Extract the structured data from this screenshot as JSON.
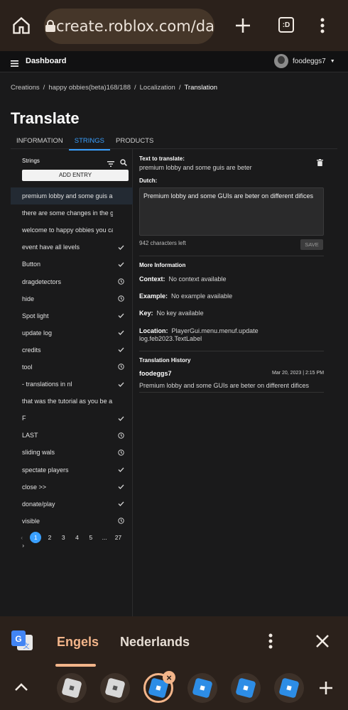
{
  "browser": {
    "url": "create.roblox.com/da",
    "tab_count": ":D"
  },
  "topnav": {
    "title": "Dashboard",
    "username": "foodeggs7"
  },
  "breadcrumb": [
    "Creations",
    "/",
    "happy obbies(beta)168/188",
    "/",
    "Localization",
    "/",
    "Translation"
  ],
  "page_title": "Translate",
  "tabs": [
    {
      "label": "INFORMATION",
      "active": false
    },
    {
      "label": "STRINGS",
      "active": true
    },
    {
      "label": "PRODUCTS",
      "active": false
    }
  ],
  "strings_panel": {
    "header": "Strings",
    "add_entry": "ADD ENTRY",
    "items": [
      {
        "text": "premium lobby and some guis are beter",
        "status": "none",
        "selected": true
      },
      {
        "text": "there are some changes in the game",
        "status": "none",
        "selected": false
      },
      {
        "text": "welcome to happy obbies you can play",
        "status": "none",
        "selected": false
      },
      {
        "text": "event have all levels",
        "status": "check",
        "selected": false
      },
      {
        "text": "Button",
        "status": "check",
        "selected": false
      },
      {
        "text": "dragdetectors",
        "status": "clock",
        "selected": false
      },
      {
        "text": "hide",
        "status": "clock",
        "selected": false
      },
      {
        "text": "Spot light",
        "status": "check",
        "selected": false
      },
      {
        "text": "update log",
        "status": "check",
        "selected": false
      },
      {
        "text": "credits",
        "status": "check",
        "selected": false
      },
      {
        "text": "tool",
        "status": "clock",
        "selected": false
      },
      {
        "text": "- translations in nl",
        "status": "check",
        "selected": false
      },
      {
        "text": "that was the tutorial as you be a.bet",
        "status": "none",
        "selected": false
      },
      {
        "text": "F",
        "status": "check",
        "selected": false
      },
      {
        "text": "LAST",
        "status": "clock",
        "selected": false
      },
      {
        "text": "sliding wals",
        "status": "clock",
        "selected": false
      },
      {
        "text": "spectate players",
        "status": "check",
        "selected": false
      },
      {
        "text": "close >>",
        "status": "check",
        "selected": false
      },
      {
        "text": "donate/play",
        "status": "check",
        "selected": false
      },
      {
        "text": "visible",
        "status": "clock",
        "selected": false
      }
    ],
    "pagination": {
      "pages": [
        "1",
        "2",
        "3",
        "4",
        "5",
        "...",
        "27"
      ],
      "current": "1",
      "prev": "‹",
      "next": "›"
    }
  },
  "translation": {
    "text_label": "Text to translate:",
    "source_text": "premium lobby and some guis are beter",
    "lang_label": "Dutch:",
    "translated_text": "Premium lobby and some GUIs are beter on different difices",
    "chars_left": "942 characters left",
    "save": "SAVE",
    "more_info_label": "More Information",
    "context_label": "Context:",
    "context_value": "No context available",
    "example_label": "Example:",
    "example_value": "No example available",
    "key_label": "Key:",
    "key_value": "No key available",
    "location_label": "Location:",
    "location_value_1": "PlayerGui.menu.menuf.update",
    "location_value_2": "log.feb2023.TextLabel",
    "history_label": "Translation History",
    "history_user": "foodeggs7",
    "history_date": "Mar 20, 2023 | 2:15 PM",
    "history_text": "Premium lobby and some GUIs are beter on different difices"
  },
  "translate_bar": {
    "lang_from": "Engels",
    "lang_to": "Nederlands"
  },
  "colors": {
    "accent": "#3aa0ff",
    "browser_bg": "#2b211b",
    "translate_accent": "#f3b58a"
  }
}
